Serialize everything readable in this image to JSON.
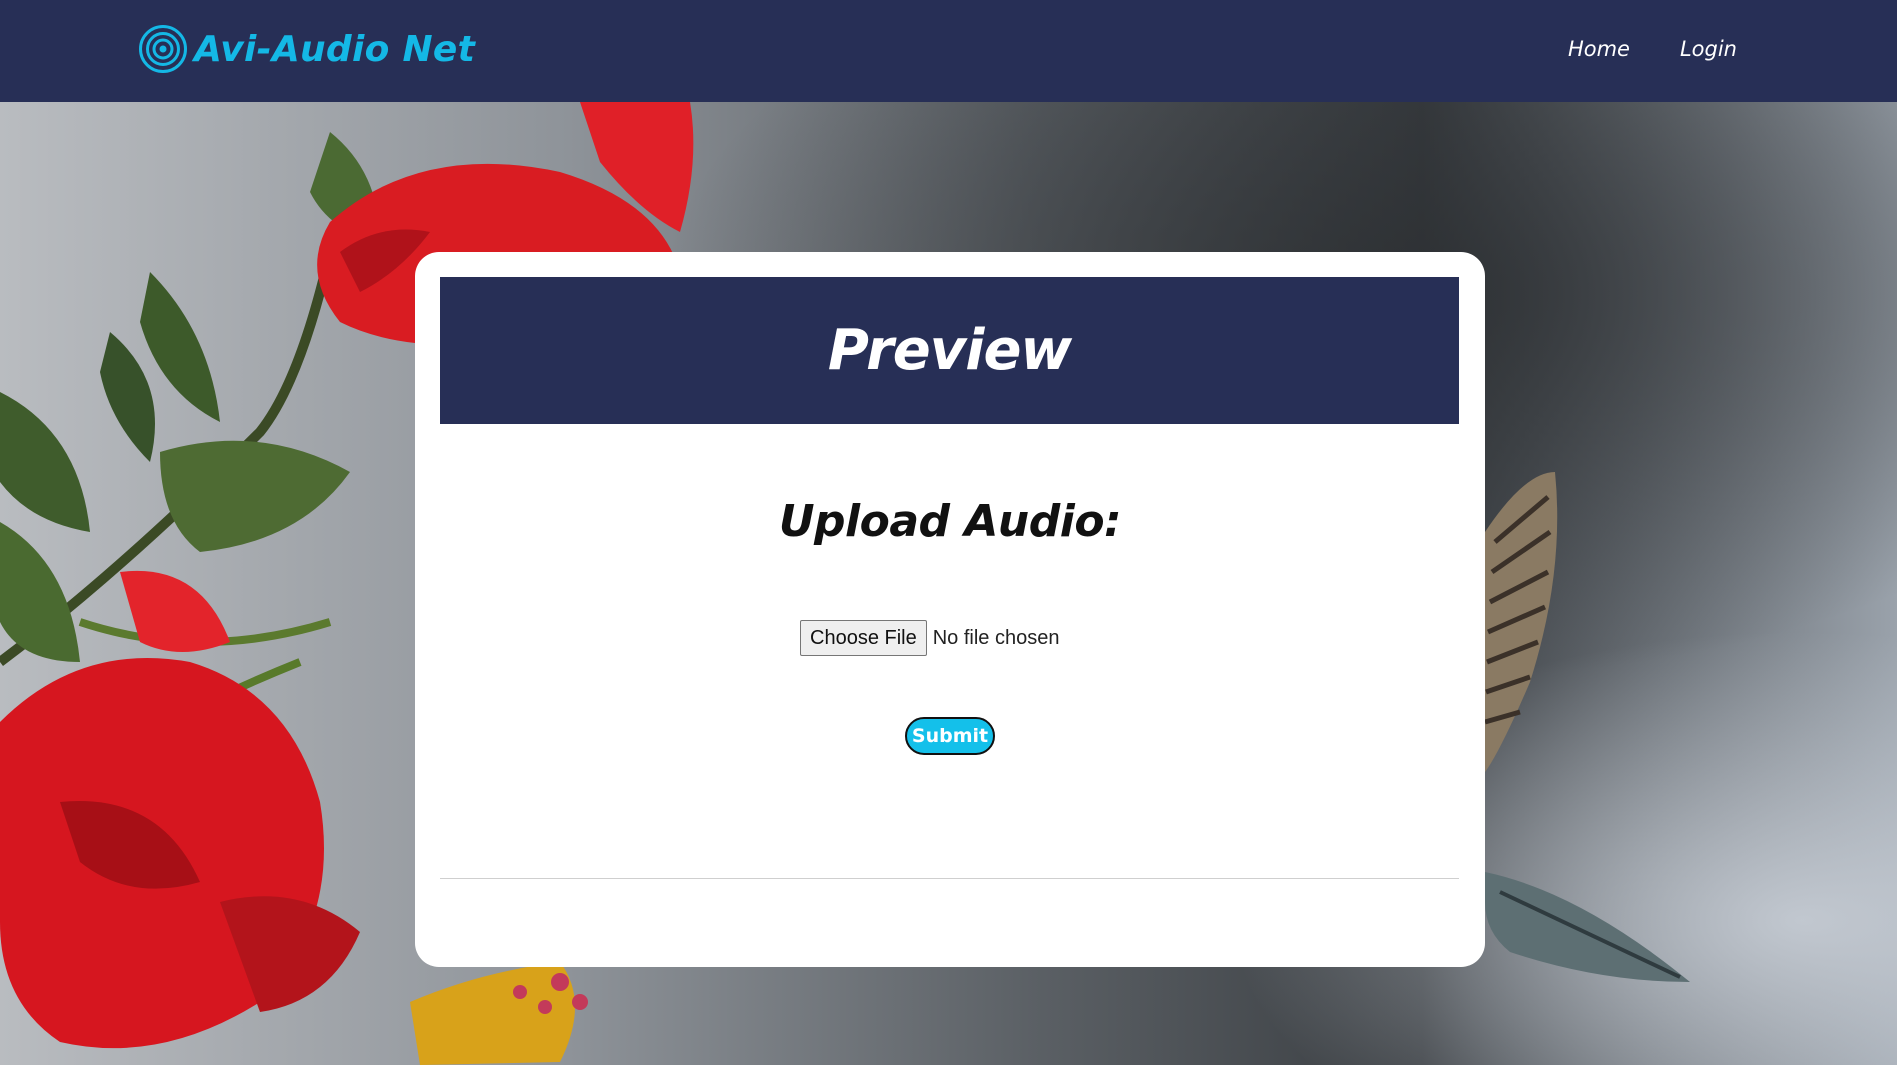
{
  "navbar": {
    "brand_name": "Avi-Audio Net",
    "brand_icon": "concentric-circles-icon",
    "links": [
      "Home",
      "Login"
    ]
  },
  "card": {
    "title": "Preview",
    "upload_heading": "Upload Audio:",
    "file_input": {
      "button_label": "Choose File",
      "status_text": "No file chosen"
    },
    "submit_label": "Submit"
  },
  "colors": {
    "navbar_bg": "#272f56",
    "brand_accent": "#14b8e6",
    "submit_bg": "#14c0ea",
    "card_bg": "#ffffff"
  }
}
